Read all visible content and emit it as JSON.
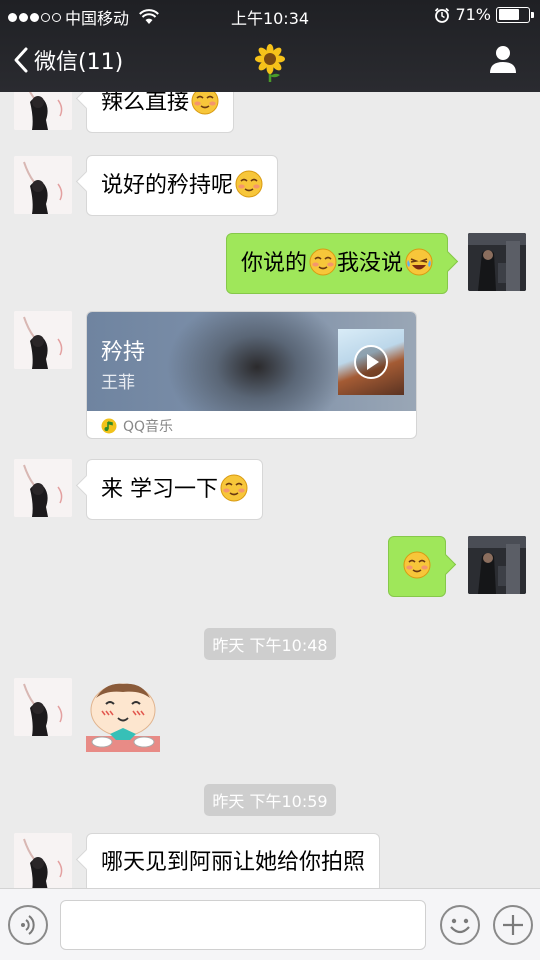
{
  "status_bar": {
    "carrier": "中国移动",
    "time": "上午10:34",
    "battery": "71%",
    "battery_level": 0.71
  },
  "nav": {
    "back_label": "微信(11)",
    "title_icon": "sunflower-icon",
    "right_icon": "profile-icon"
  },
  "messages": {
    "m1": {
      "text": "辣么直接",
      "emoji": "blush-emoji"
    },
    "m2": {
      "text": "说好的矜持呢",
      "emoji": "blush-emoji"
    },
    "m3": {
      "text_a": "你说的",
      "text_b": "我没说",
      "emoji": "blush-emoji",
      "emoji_2": "laugh-cry-emoji"
    },
    "music": {
      "title": "矜持",
      "artist": "王菲",
      "source": "QQ音乐"
    },
    "m5": {
      "text": "来 学习一下",
      "emoji": "blush-emoji"
    },
    "m6": {
      "emoji": "blush-emoji"
    },
    "time1": "昨天  下午10:48",
    "m7": {
      "sticker": "blushing-cartoon-sticker"
    },
    "time2": "昨天  下午10:59",
    "m8": {
      "text": "哪天见到阿丽让她给你拍照"
    }
  },
  "input_bar": {
    "voice_icon": "voice-icon",
    "emoji_icon": "emoji-icon",
    "plus_icon": "plus-icon",
    "placeholder": ""
  },
  "colors": {
    "nav_bg": "#2a2b30",
    "chat_bg": "#ebebeb",
    "bubble_right": "#9fe75a",
    "bubble_left": "#ffffff"
  }
}
